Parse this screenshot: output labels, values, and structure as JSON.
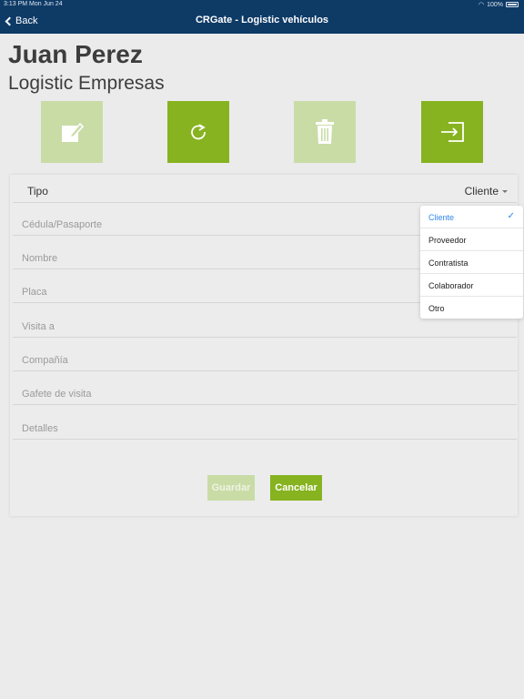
{
  "status_bar": {
    "time": "3:13 PM   Mon Jun 24",
    "battery": "100%"
  },
  "nav": {
    "back_label": "Back",
    "title": "CRGate - Logistic vehículos"
  },
  "person": {
    "name": "Juan Perez",
    "company": "Logistic Empresas"
  },
  "actions": [
    {
      "icon": "edit-icon",
      "enabled": false
    },
    {
      "icon": "refresh-icon",
      "enabled": true
    },
    {
      "icon": "trash-icon",
      "enabled": false
    },
    {
      "icon": "exit-icon",
      "enabled": true
    }
  ],
  "form": {
    "tipo_label": "Tipo",
    "tipo_value": "Cliente",
    "fields": [
      {
        "placeholder": "Cédula/Pasaporte"
      },
      {
        "placeholder": "Nombre"
      },
      {
        "placeholder": "Placa"
      },
      {
        "placeholder": "Visita a"
      },
      {
        "placeholder": "Compañía"
      },
      {
        "placeholder": "Gafete de visita"
      },
      {
        "placeholder": "Detalles"
      }
    ],
    "save_label": "Guardar",
    "cancel_label": "Cancelar"
  },
  "dropdown": {
    "options": [
      "Cliente",
      "Proveedor",
      "Contratista",
      "Colaborador",
      "Otro"
    ],
    "selected": "Cliente"
  },
  "colors": {
    "navbar": "#0e3a66",
    "accent": "#86b31f",
    "accent_disabled": "#c9dca6",
    "selected_option": "#2f86e8"
  }
}
